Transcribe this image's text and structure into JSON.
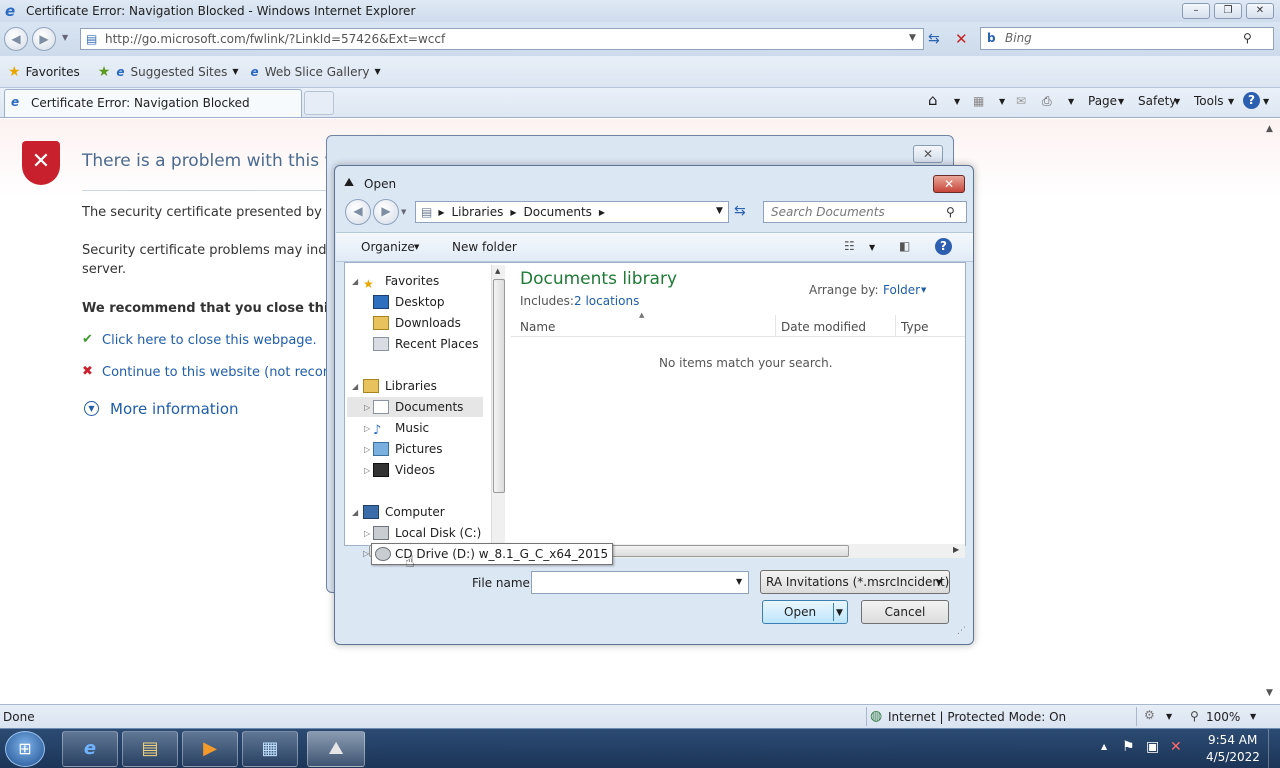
{
  "browser": {
    "title": "Certificate Error: Navigation Blocked - Windows Internet Explorer",
    "url": "http://go.microsoft.com/fwlink/?LinkId=57426&Ext=wccf",
    "search_placeholder": "Bing",
    "favorites_label": "Favorites",
    "suggested_sites": "Suggested Sites",
    "web_slice_gallery": "Web Slice Gallery",
    "tab_title": "Certificate Error: Navigation Blocked",
    "cmd": {
      "page": "Page",
      "safety": "Safety",
      "tools": "Tools"
    }
  },
  "page": {
    "heading": "There is a problem with this we",
    "line1": "The security certificate presented by this",
    "line2a": "Security certificate problems may indicat",
    "line2b": "server.",
    "recommend": "We recommend that you close this w",
    "close_link": "Click here to close this webpage.",
    "continue_link": "Continue to this website (not recomm",
    "more_info": "More information"
  },
  "dialog": {
    "title": "Open",
    "breadcrumb": [
      "Libraries",
      "Documents"
    ],
    "search_placeholder": "Search Documents",
    "organize": "Organize",
    "new_folder": "New folder",
    "library_title": "Documents library",
    "includes_label": "Includes:",
    "includes_link": "2 locations",
    "arrange_by": "Arrange by:",
    "arrange_value": "Folder",
    "columns": [
      "Name",
      "Date modified",
      "Type"
    ],
    "empty_message": "No items match your search.",
    "tree": {
      "favorites": "Favorites",
      "desktop": "Desktop",
      "downloads": "Downloads",
      "recent": "Recent Places",
      "libraries": "Libraries",
      "documents": "Documents",
      "music": "Music",
      "pictures": "Pictures",
      "videos": "Videos",
      "computer": "Computer",
      "local_disk": "Local Disk (C:)",
      "cd_drive": "CD Drive (D:) w_8.1_G_C_x64_2015"
    },
    "file_name_label": "File name:",
    "file_name_value": "",
    "file_type": "RA Invitations (*.msrcIncident)",
    "open_button": "Open",
    "cancel_button": "Cancel"
  },
  "status": {
    "left": "Done",
    "zone": "Internet | Protected Mode: On",
    "zoom": "100%"
  },
  "clock": {
    "time": "9:54 AM",
    "date": "4/5/2022"
  }
}
